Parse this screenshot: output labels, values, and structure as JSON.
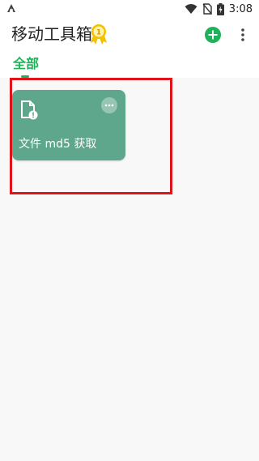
{
  "status_bar": {
    "time": "3:08",
    "icons": [
      "app-notification-icon",
      "wifi-icon",
      "no-sim-icon",
      "battery-charging-icon"
    ]
  },
  "app_bar": {
    "title": "移动工具箱",
    "badge_icon": "medal-icon",
    "actions": [
      "add-icon",
      "more-vert-icon"
    ],
    "accent_color": "#1fb25a"
  },
  "tabs": [
    {
      "label": "全部",
      "selected": true
    }
  ],
  "tools": [
    {
      "label": "文件 md5 获取",
      "icon": "file-info-icon",
      "color": "#5ea78d"
    }
  ],
  "highlight_color": "#e0131b"
}
